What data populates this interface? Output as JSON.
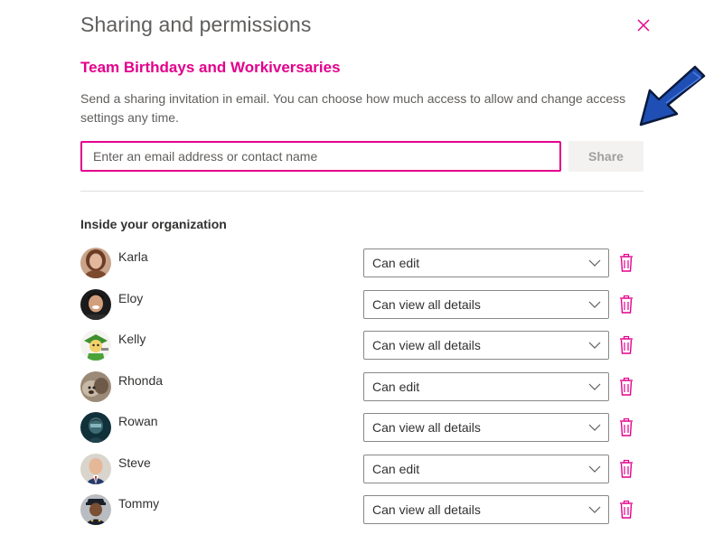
{
  "dialog": {
    "title": "Sharing and permissions",
    "close_icon": "close-icon"
  },
  "list_title": "Team Birthdays and Workiversaries",
  "description": "Send a sharing invitation in email. You can choose how much access to allow and change access settings any time.",
  "invite": {
    "placeholder": "Enter an email address or contact name",
    "value": "",
    "share_label": "Share"
  },
  "section_heading": "Inside your organization",
  "people": [
    {
      "name": "Karla",
      "permission": "Can edit"
    },
    {
      "name": "Eloy",
      "permission": "Can view all details"
    },
    {
      "name": "Kelly",
      "permission": "Can view all details"
    },
    {
      "name": "Rhonda",
      "permission": "Can edit"
    },
    {
      "name": "Rowan",
      "permission": "Can view all details"
    },
    {
      "name": "Steve",
      "permission": "Can edit"
    },
    {
      "name": "Tommy",
      "permission": "Can view all details"
    }
  ],
  "icons": {
    "select": "chevron-down-icon",
    "delete": "trash-icon",
    "annotation": "arrow-icon"
  },
  "colors": {
    "accent": "#e3008c",
    "arrow": "#1f4fb5"
  }
}
